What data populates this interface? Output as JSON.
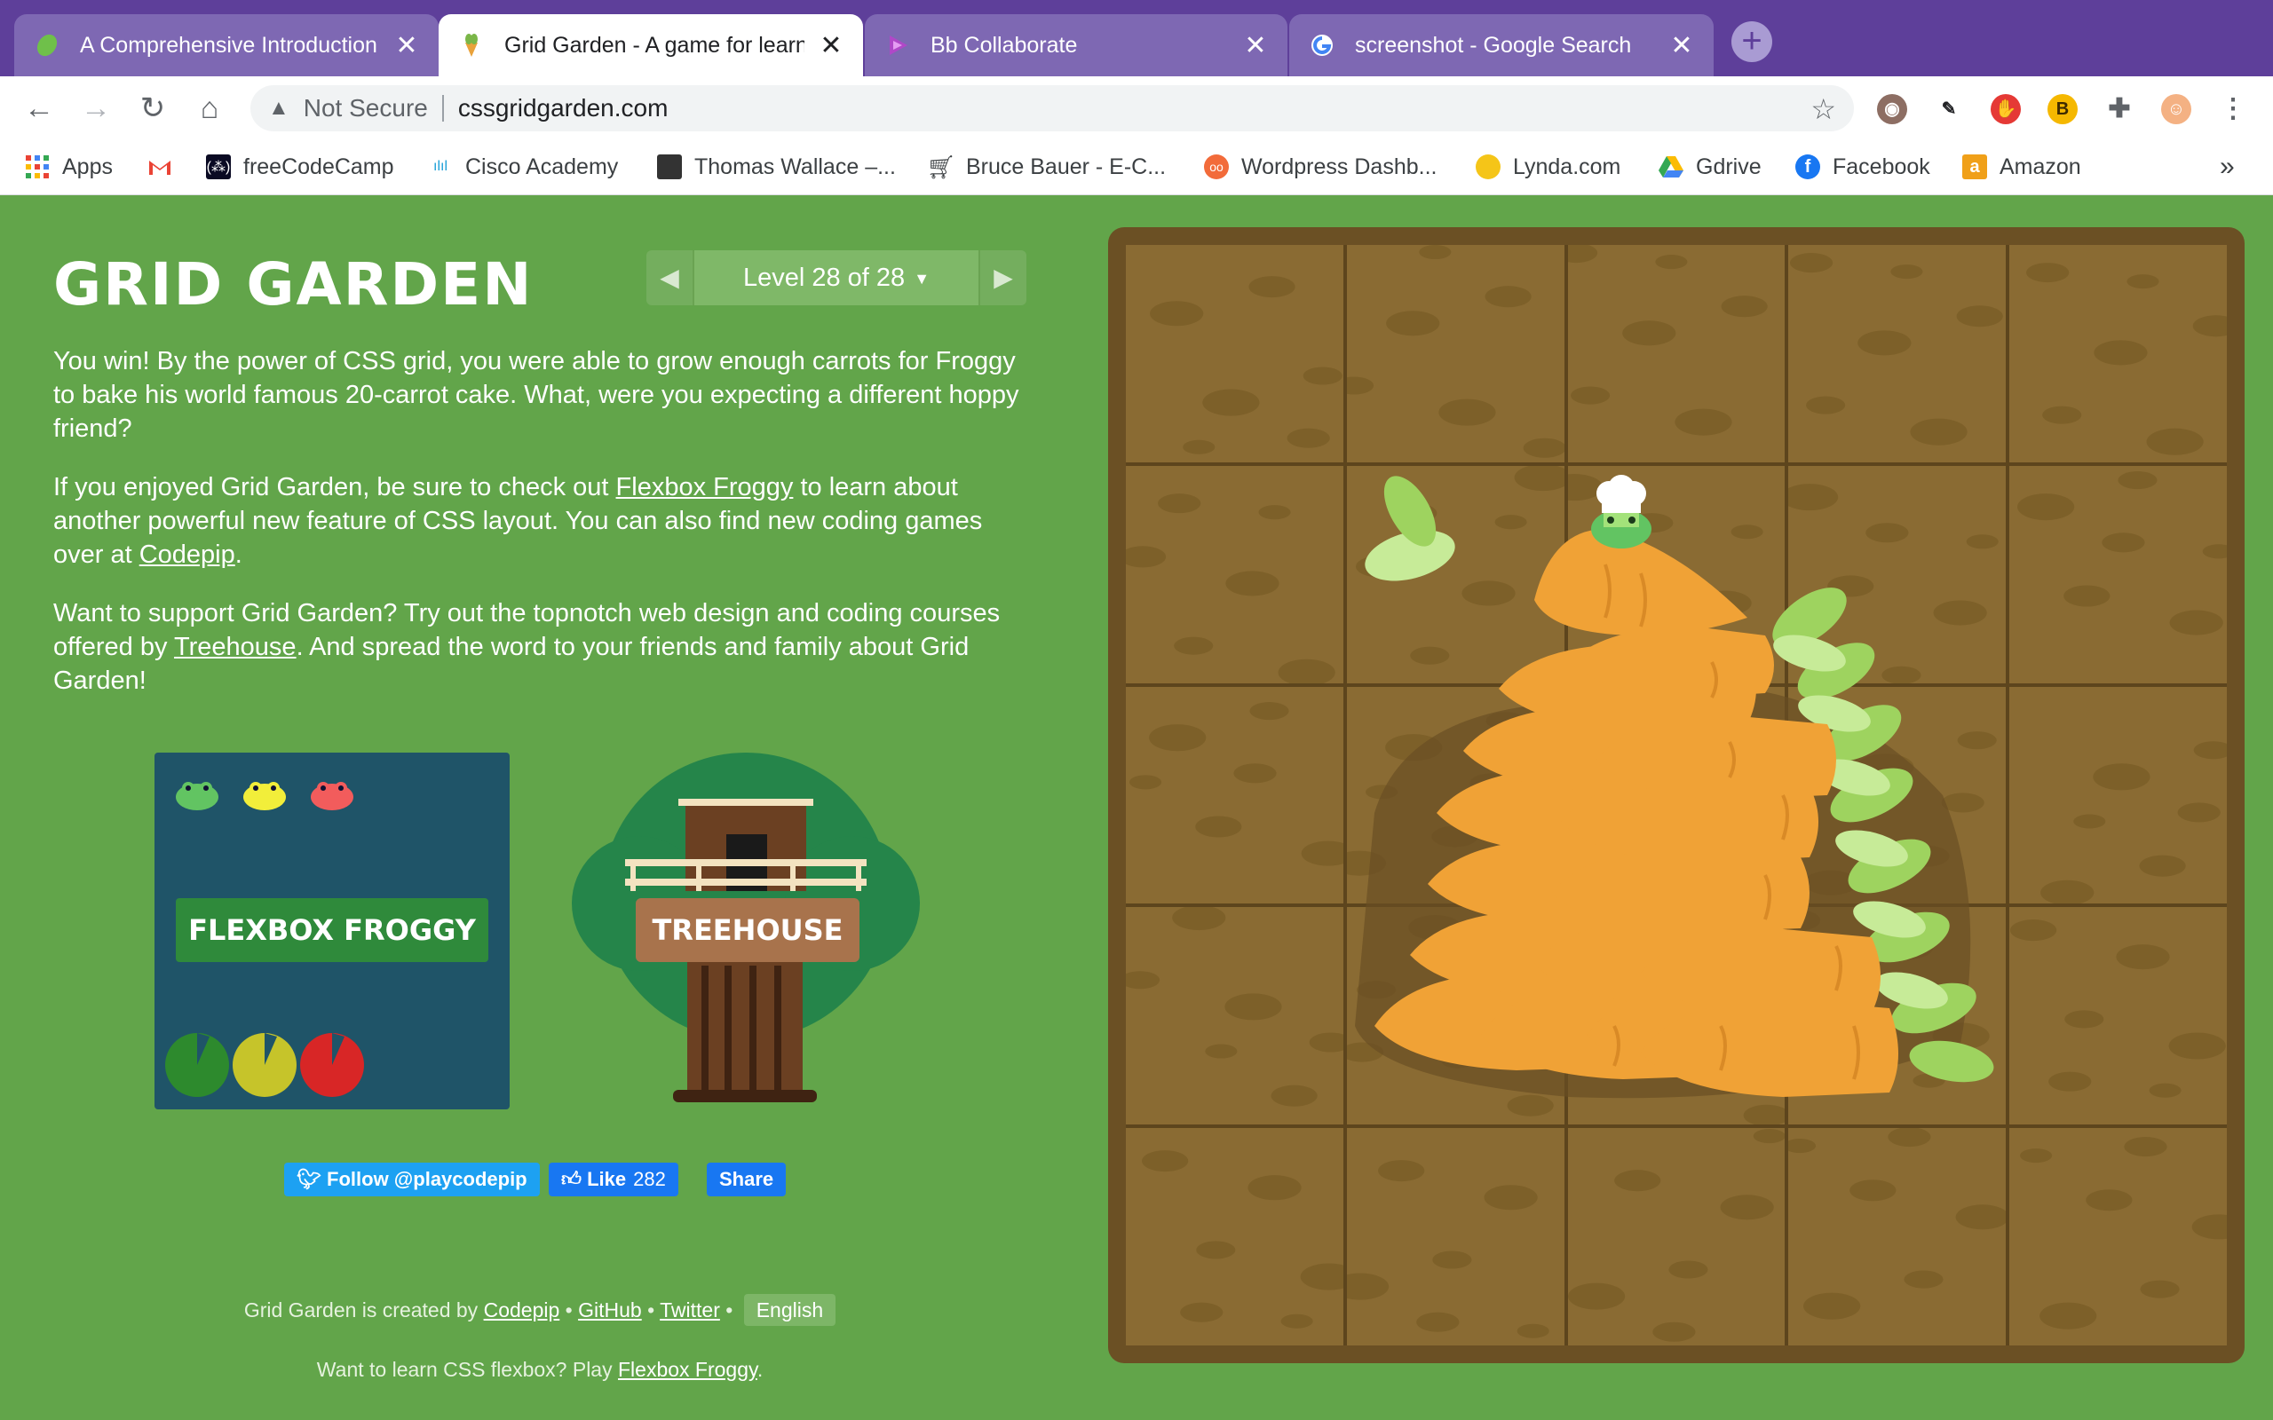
{
  "browser": {
    "tabs": [
      {
        "title": "A Comprehensive Introduction",
        "active": false
      },
      {
        "title": "Grid Garden - A game for learn",
        "active": true
      },
      {
        "title": "Bb Collaborate",
        "active": false
      },
      {
        "title": "screenshot - Google Search",
        "active": false
      }
    ],
    "address": {
      "security": "Not Secure",
      "url": "cssgridgarden.com"
    },
    "bookmarks": [
      "Apps",
      "freeCodeCamp",
      "Cisco Academy",
      "Thomas Wallace –...",
      "Bruce Bauer - E-C...",
      "Wordpress Dashb...",
      "Lynda.com",
      "Gdrive",
      "Facebook",
      "Amazon"
    ],
    "extension_badge": "B"
  },
  "page": {
    "title": "GRID GARDEN",
    "level": {
      "indicator": "Level 28 of 28",
      "current": 28,
      "total": 28
    },
    "paragraphs": {
      "p1": "You win! By the power of CSS grid, you were able to grow enough carrots for Froggy to bake his world famous 20-carrot cake. What, were you expecting a different hoppy friend?",
      "p2_before": "If you enjoyed Grid Garden, be sure to check out ",
      "p2_link1": "Flexbox Froggy",
      "p2_middle": " to learn about another powerful new feature of CSS layout. You can also find new coding games over at ",
      "p2_link2": "Codepip",
      "p2_after": ".",
      "p3_before": "Want to support Grid Garden? Try out the topnotch web design and coding courses offered by ",
      "p3_link": "Treehouse",
      "p3_after": ". And spread the word to your friends and family about Grid Garden!"
    },
    "promos": {
      "froggy_label": "FLEXBOX FROGGY",
      "treehouse_label": "TREEHOUSE"
    },
    "social": {
      "twitter": "Follow @playcodepip",
      "like": "Like",
      "like_count": "282",
      "share": "Share"
    },
    "footer": {
      "created_by": "Grid Garden is created by ",
      "codepip": "Codepip",
      "github": "GitHub",
      "twitter": "Twitter",
      "bullet": " • ",
      "language": "English",
      "flexbox_text": "Want to learn CSS flexbox? Play ",
      "flexbox_link": "Flexbox Froggy",
      "flexbox_end": "."
    }
  },
  "board": {
    "columns": 5,
    "rows": 5
  },
  "colors": {
    "page_bg": "#62a54a",
    "tabbar": "#5e3f9a",
    "soil": "#8a6b33",
    "board_frame": "#6b5024",
    "carrot": "#f0a236",
    "carrot_top": "#9ed35f"
  }
}
